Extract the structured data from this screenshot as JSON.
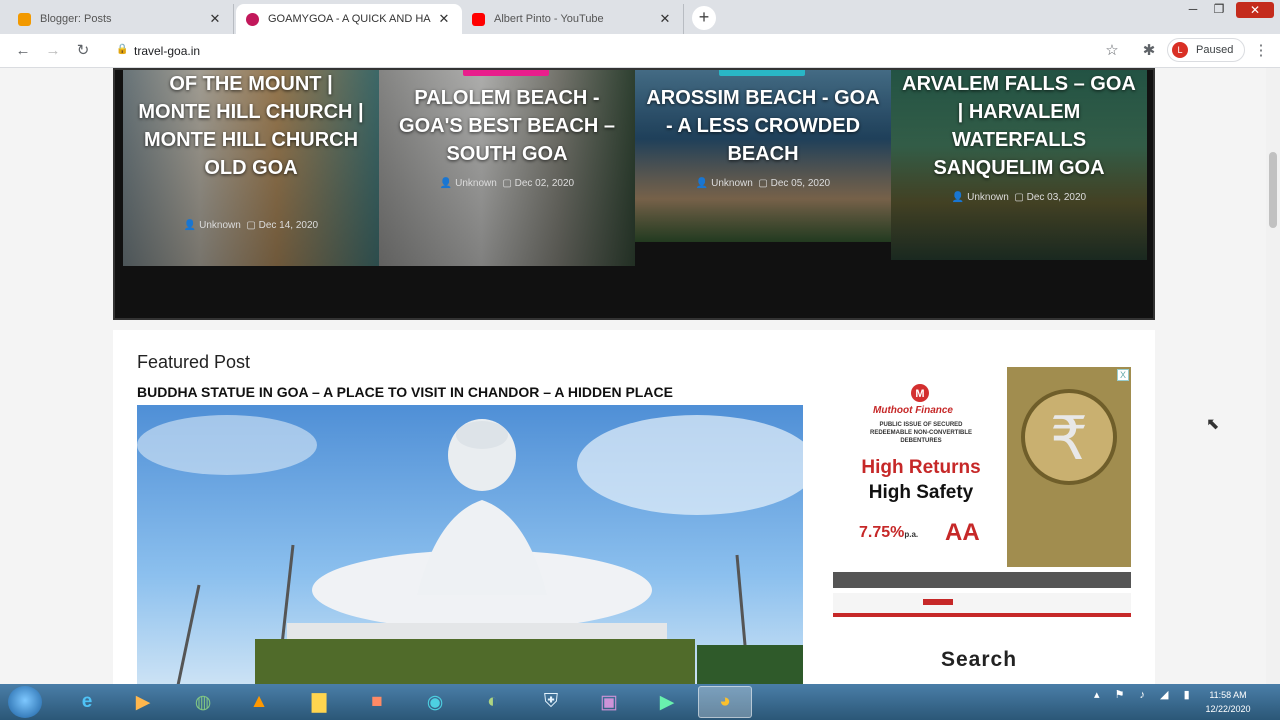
{
  "browser": {
    "tabs": [
      {
        "title": "Blogger: Posts",
        "favicon_color": "#f29900",
        "active": false
      },
      {
        "title": "GOAMYGOA - A QUICK AND HA",
        "favicon_color": "#c2185b",
        "active": true
      },
      {
        "title": "Albert Pinto - YouTube",
        "favicon_color": "#ff0000",
        "active": false
      }
    ],
    "new_tab_label": "+",
    "url": "travel-goa.in",
    "profile_initial": "L",
    "profile_status": "Paused"
  },
  "post_grid": [
    {
      "title": "OF THE MOUNT | MONTE HILL CHURCH | MONTE HILL CHURCH OLD GOA",
      "author": "Unknown",
      "date": "Dec 14, 2020",
      "image": "church"
    },
    {
      "title": "PALOLEM BEACH - GOA'S BEST BEACH – SOUTH GOA",
      "author": "Unknown",
      "date": "Dec 02, 2020",
      "image": "palolem",
      "category_color": "#e91e8c"
    },
    {
      "title": "AROSSIM BEACH - GOA - A LESS CROWDED BEACH",
      "author": "Unknown",
      "date": "Dec 05, 2020",
      "image": "arossim",
      "category_color": "#29b6c6"
    },
    {
      "title": "ARVALEM FALLS – GOA | HARVALEM WATERFALLS SANQUELIM GOA",
      "author": "Unknown",
      "date": "Dec 03, 2020",
      "image": "arvalem"
    }
  ],
  "featured": {
    "heading": "Featured Post",
    "title": "BUDDHA STATUE IN GOA – A PLACE TO VISIT IN CHANDOR – A HIDDEN PLACE"
  },
  "ad": {
    "brand": "Muthoot Finance",
    "line1": "PUBLIC ISSUE OF SECURED",
    "line2": "REDEEMABLE NON-CONVERTIBLE",
    "line3": "DEBENTURES",
    "headline": "High Returns",
    "subheadline": "High Safety",
    "rate": "7.75%",
    "rate_suffix": "p.a.",
    "rating": "AA",
    "close_label": "X"
  },
  "sidebar": {
    "search_heading": "Search"
  },
  "taskbar": {
    "apps": [
      "internet-explorer",
      "media-player",
      "network-globe",
      "vlc",
      "file-explorer",
      "app-orange",
      "edge",
      "globe-green",
      "shield",
      "app-purple",
      "app-green",
      "chrome"
    ],
    "time": "11:58 AM",
    "date": "12/22/2020"
  }
}
